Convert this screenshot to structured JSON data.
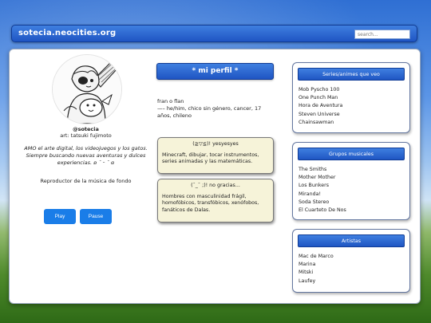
{
  "header": {
    "site_title": "sotecia.neocities.org",
    "search_placeholder": "search..."
  },
  "left": {
    "avatar_alt": "anime character holding a chainsaw and a dog",
    "handle": "@sotecia",
    "art_credit": "art: tatsuki fujimoto",
    "bio": "AMO el arte digital, los videojuegos y los gatos. Siempre buscando nuevas aventuras y dulces experiencias. ʚ ˘ ᵕ ˘ ɞ",
    "player_label": "Reproductor de la música de fondo",
    "play_label": "Play",
    "pause_label": "Pause"
  },
  "profile": {
    "title": "* mi perfil *",
    "line1": "fran o flan",
    "line2": "—– he/him, chico sin género, cancer, 17 años, chileno"
  },
  "likes": {
    "title": "(≧▽≦)! yesyesyes",
    "text": "Minecraft, dibujar, tocar instrumentos, series animadas y las matemáticas."
  },
  "dislikes": {
    "title": "(¯_¯ ;)! no gracias...",
    "text": "Hombres con masculinidad frágil, homofóbicos, transfóbicos, xenófobos, fanáticos de Dalas."
  },
  "series": {
    "title": "Series/animes que veo",
    "items": [
      "Mob Pyscho 100",
      "One Punch Man",
      "Hora de Aventura",
      "Steven Universe",
      "Chainsawman"
    ]
  },
  "bands": {
    "title": "Grupos musicales",
    "items": [
      "The Smiths",
      "Mother Mother",
      "Los Bunkers",
      "Miranda!",
      "Soda Stereo",
      "El Cuarteto De Nos"
    ]
  },
  "artists": {
    "title": "Artistas",
    "items": [
      "Mac de Marco",
      "Marina",
      "Mitski",
      "Laufey"
    ]
  }
}
